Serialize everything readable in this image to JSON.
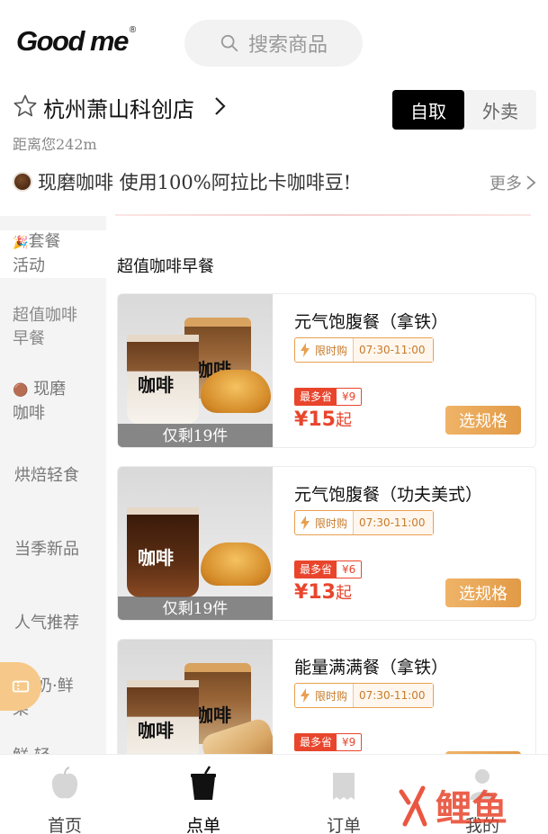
{
  "brand": {
    "logo": "Good me",
    "reg": "®"
  },
  "search": {
    "placeholder": "搜索商品"
  },
  "store": {
    "name": "杭州萧山科创店",
    "distance": "距离您242m"
  },
  "mode_toggle": {
    "options": [
      "自取",
      "外卖"
    ],
    "selected": "自取"
  },
  "notice": {
    "text": "现磨咖啡 使用100%阿拉比卡咖啡豆!",
    "more": "更多"
  },
  "sidebar": {
    "items": [
      {
        "icon": "party-popper-icon",
        "label": "套餐",
        "label2": "活动"
      },
      {
        "label": "超值咖啡",
        "label2": "早餐",
        "active": true
      },
      {
        "icon": "coffee-bean-icon",
        "label": "现磨",
        "label2": "咖啡"
      },
      {
        "label": "烘焙轻食"
      },
      {
        "label": "当季新品"
      },
      {
        "label": "人气推荐"
      },
      {
        "label": "奶·鲜",
        "label2": "果",
        "prefix": "鲜"
      },
      {
        "label": "鲜 轻"
      }
    ]
  },
  "section": {
    "title": "超值咖啡早餐"
  },
  "products": [
    {
      "title": "元气饱腹餐（拿铁）",
      "limit_label": "限时购",
      "time": "07:30-11:00",
      "save_label": "最多省",
      "save_value": "¥9",
      "price_symbol": "¥",
      "price": "15",
      "price_suffix": "起",
      "button": "选规格",
      "remaining": "仅剩19件"
    },
    {
      "title": "元气饱腹餐（功夫美式）",
      "limit_label": "限时购",
      "time": "07:30-11:00",
      "save_label": "最多省",
      "save_value": "¥6",
      "price_symbol": "¥",
      "price": "13",
      "price_suffix": "起",
      "button": "选规格",
      "remaining": "仅剩19件"
    },
    {
      "title": "能量满满餐（拿铁）",
      "limit_label": "限时购",
      "time": "07:30-11:00",
      "save_label": "最多省",
      "save_value": "¥9"
    }
  ],
  "cup_text": "咖啡",
  "tabbar": {
    "items": [
      {
        "label": "首页",
        "icon": "apple-icon"
      },
      {
        "label": "点单",
        "icon": "cup-icon",
        "active": true
      },
      {
        "label": "订单",
        "icon": "receipt-icon"
      },
      {
        "label": "我的",
        "icon": "profile-icon"
      }
    ]
  },
  "colors": {
    "accent": "#e8452c",
    "button": "#e8a050",
    "dark": "#000000"
  },
  "watermark": {
    "text": "鲤鱼"
  }
}
